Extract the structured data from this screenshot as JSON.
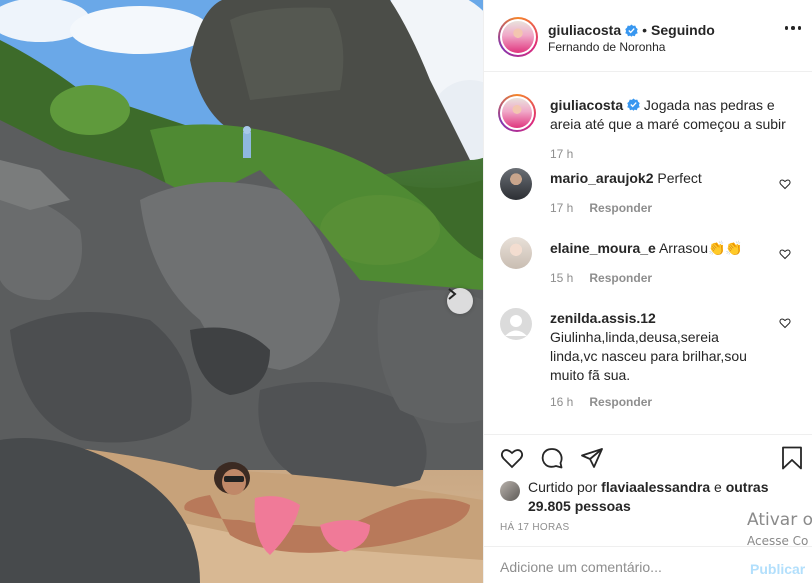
{
  "post": {
    "username": "giuliacosta",
    "follow_status": "Seguindo",
    "separator": "•",
    "location": "Fernando de Noronha"
  },
  "caption": {
    "username": "giuliacosta",
    "text": "Jogada nas pedras e areia até que a maré começou a subir",
    "time": "17 h"
  },
  "comments": [
    {
      "username": "mario_araujok2",
      "text": "Perfect",
      "time": "17 h",
      "reply_label": "Responder"
    },
    {
      "username": "elaine_moura_e",
      "text": "Arrasou👏👏",
      "time": "15 h",
      "reply_label": "Responder"
    },
    {
      "username": "zenilda.assis.12",
      "text": "Giulinha,linda,deusa,sereia linda,vc nasceu para brilhar,sou muito fã sua.",
      "time": "16 h",
      "reply_label": "Responder"
    }
  ],
  "likes": {
    "prefix": "Curtido por",
    "user": "flaviaalessandra",
    "conj": "e",
    "others": "outras 29.805 pessoas"
  },
  "timestamp": "HÁ 17 HORAS",
  "add_comment": {
    "placeholder": "Adicione um comentário...",
    "publish_label": "Publicar"
  },
  "watermark": {
    "line1": "Ativar o",
    "line2": "Acesse Co"
  },
  "icons": {
    "verified": "verified-badge-icon",
    "more": "more-options-icon",
    "like": "heart-icon",
    "comment": "comment-bubble-icon",
    "share": "paper-plane-icon",
    "save": "bookmark-icon",
    "next": "chevron-right-icon"
  },
  "colors": {
    "text": "#262626",
    "muted": "#8e8e8e",
    "verified_blue": "#3897f0",
    "publish_disabled": "#b2dffc",
    "divider": "#efefef"
  }
}
